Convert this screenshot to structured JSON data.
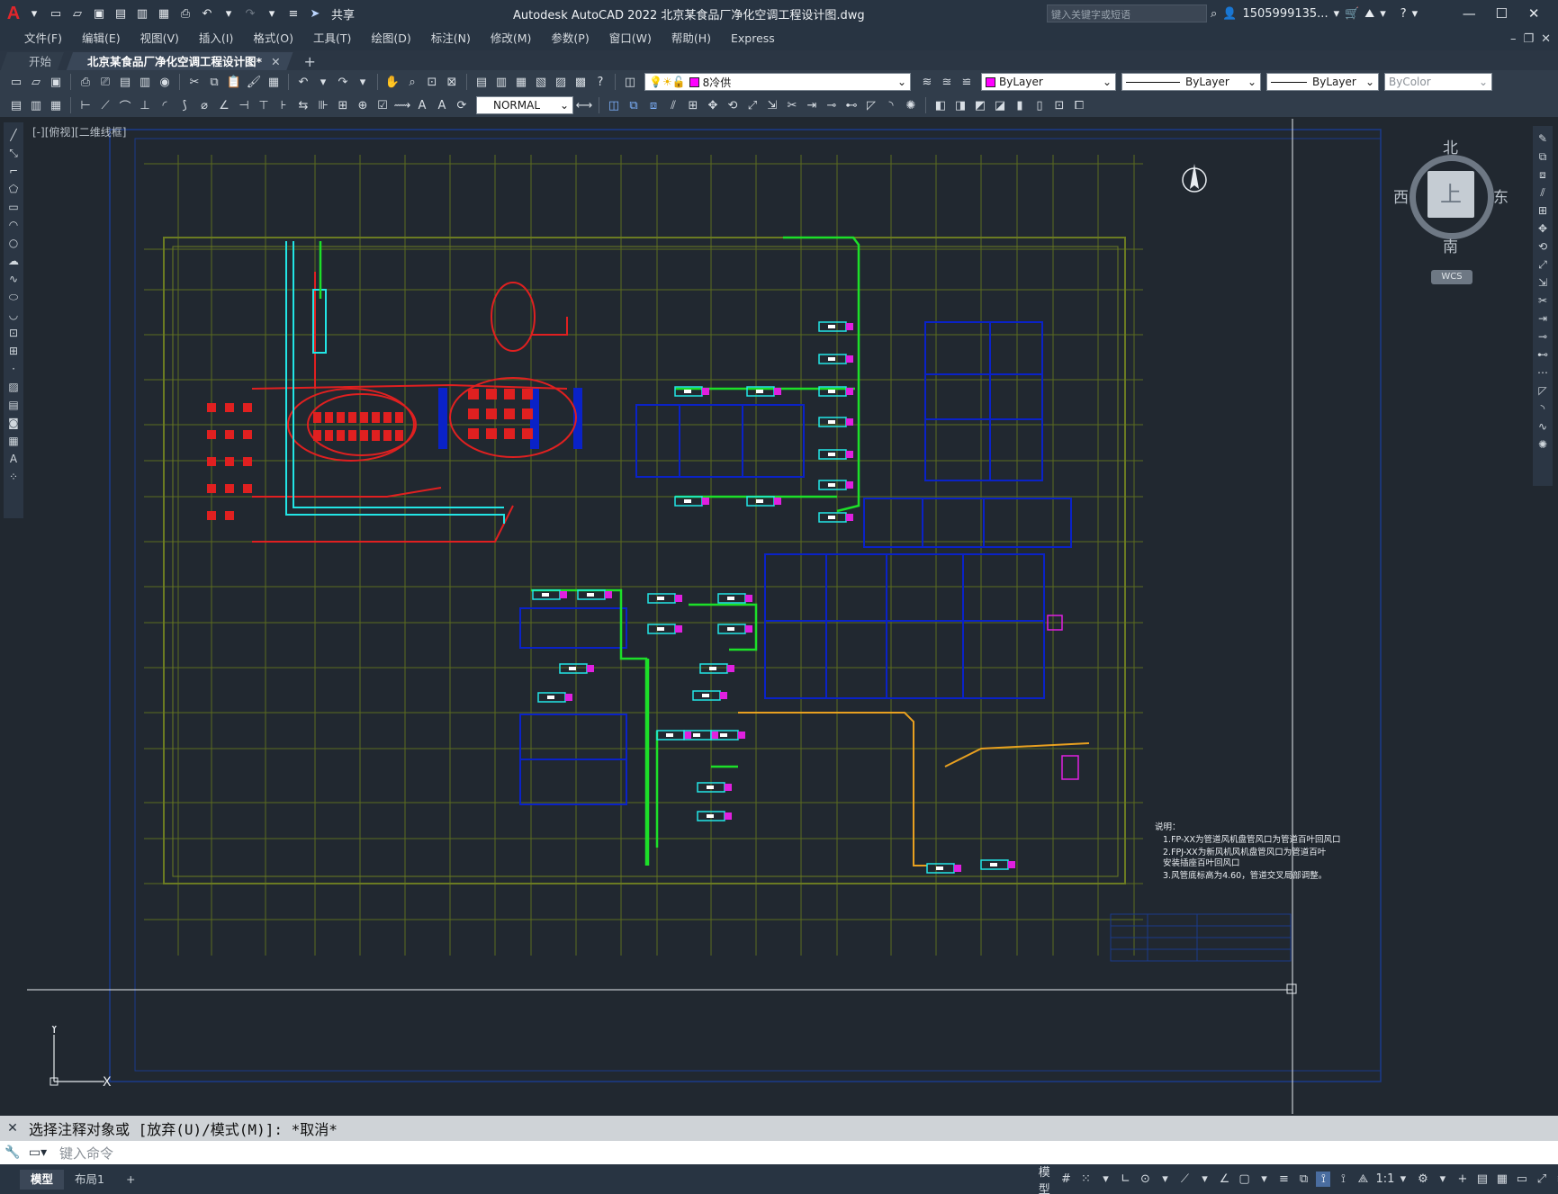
{
  "app": {
    "title": "Autodesk AutoCAD 2022    北京某食品厂净化空调工程设计图.dwg",
    "search_placeholder": "键入关键字或短语",
    "user": "1505999135...",
    "share_label": "共享"
  },
  "menu": [
    "文件(F)",
    "编辑(E)",
    "视图(V)",
    "插入(I)",
    "格式(O)",
    "工具(T)",
    "绘图(D)",
    "标注(N)",
    "修改(M)",
    "参数(P)",
    "窗口(W)",
    "帮助(H)",
    "Express"
  ],
  "tabs": {
    "start": "开始",
    "drawing": "北京某食品厂净化空调工程设计图*"
  },
  "layer_combo": "8冷供",
  "color_combo": "ByLayer",
  "linetype_combo": "ByLayer",
  "lineweight_combo": "ByLayer",
  "plotstyle_combo": "ByColor",
  "dimstyle_combo": "NORMAL",
  "viewport_label": "[-][俯视][二维线框]",
  "viewcube": {
    "north": "北",
    "south": "南",
    "west": "西",
    "east": "东",
    "top": "上",
    "wcs": "WCS"
  },
  "ucs": {
    "x": "X",
    "y": "Y"
  },
  "notes": {
    "heading": "说明：",
    "lines": [
      "1.FP-XX为管道风机盘管风口为管道百叶回风口",
      "2.FPJ-XX为新风机风机盘管风口为管道百叶",
      "  安装插座百叶回风口",
      "3.风管底标高为4.60，管道交叉局部调整。"
    ]
  },
  "command": {
    "history": "选择注释对象或 [放弃(U)/模式(M)]: *取消*",
    "placeholder": "键入命令"
  },
  "layout_tabs": [
    "模型",
    "布局1"
  ],
  "status": {
    "model": "模型",
    "scale": "1:1"
  },
  "colors": {
    "titlebar": "#283442",
    "canvas": "#212830",
    "grid": "#5c6b1f",
    "wall": "#0a22c8",
    "duct_green": "#1ddf29",
    "duct_red": "#e02020",
    "cyan": "#22e5e5",
    "magenta": "#e020e0"
  }
}
